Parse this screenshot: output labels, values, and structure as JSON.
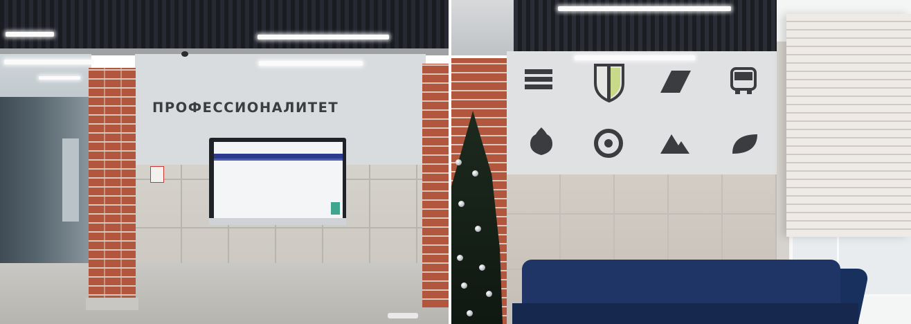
{
  "scene": {
    "sign_text": "ПРОФЕССИОНАЛИТЕТ",
    "panels": [
      "left-lobby-photo",
      "right-lobby-photo"
    ],
    "colors": {
      "brick": "#b2573e",
      "wall": "#d9dcdf",
      "ceiling": "#1a1c22",
      "sofa": "#1e3566",
      "icons": "#3a3c3f",
      "shield_accent": "#c9d98a",
      "screen_bar": "#2d3b8f"
    },
    "wall_icons": [
      "layers-icon",
      "shield-icon",
      "parallelogram-icon",
      "bus-icon",
      "pinecone-icon",
      "target-icon",
      "mountains-icon",
      "leaf-icon"
    ]
  }
}
